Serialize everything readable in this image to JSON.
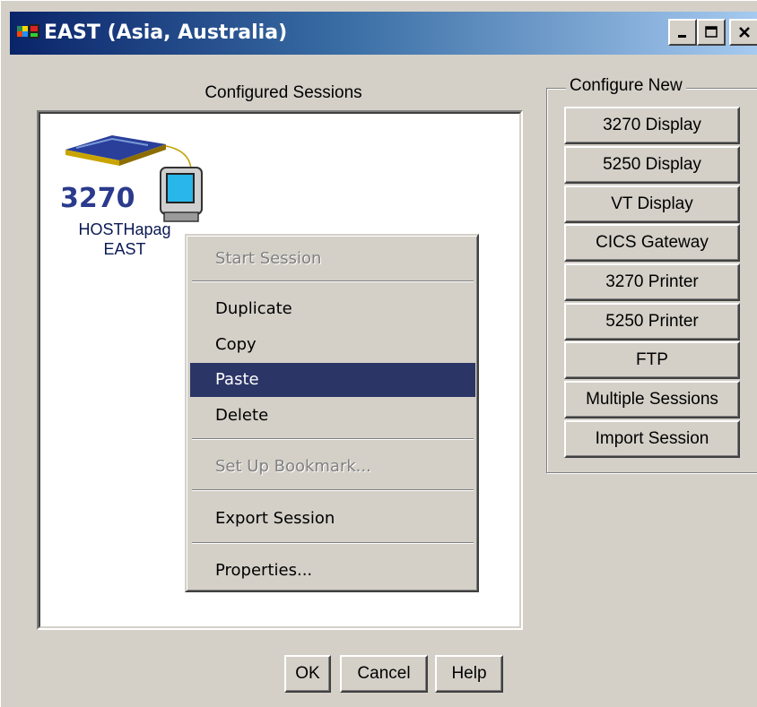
{
  "window": {
    "title": "EAST (Asia, Australia)",
    "controls": {
      "minimize": "_",
      "maximize": "□",
      "close": "×"
    }
  },
  "sessions_panel": {
    "label": "Configured Sessions",
    "items": [
      {
        "type_badge": "3270",
        "name_line1": "HOSTHapag",
        "name_line2": "EAST",
        "icon": "3270-terminal-icon"
      }
    ]
  },
  "context_menu": {
    "items": [
      {
        "label": "Start Session",
        "disabled": true
      },
      {
        "label": "Duplicate"
      },
      {
        "label": "Copy"
      },
      {
        "label": "Paste",
        "selected": true
      },
      {
        "label": "Delete"
      },
      {
        "label": "Set Up Bookmark...",
        "disabled": true
      },
      {
        "label": "Export Session"
      },
      {
        "label": "Properties..."
      }
    ]
  },
  "configure_new": {
    "legend": "Configure New",
    "buttons": [
      "3270 Display",
      "5250 Display",
      "VT Display",
      "CICS Gateway",
      "3270 Printer",
      "5250 Printer",
      "FTP",
      "Multiple Sessions",
      "Import Session"
    ]
  },
  "dialog_buttons": {
    "ok": "OK",
    "cancel": "Cancel",
    "help": "Help"
  },
  "colors": {
    "face": "#d4d0c8",
    "titlebar": "#0a246a",
    "menu_highlight": "#2b3566"
  }
}
